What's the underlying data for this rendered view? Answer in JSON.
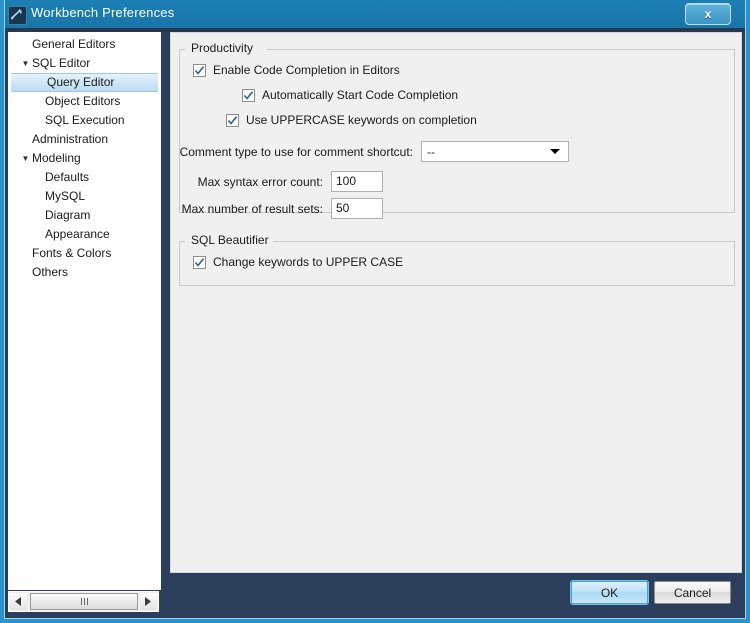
{
  "window": {
    "title": "Workbench Preferences",
    "icon": "workbench-icon",
    "close_label": "x"
  },
  "sidebar": {
    "items": [
      {
        "label": "General Editors",
        "level": 1,
        "twisty": "",
        "selected": false
      },
      {
        "label": "SQL Editor",
        "level": 1,
        "twisty": "▼",
        "selected": false
      },
      {
        "label": "Query Editor",
        "level": 2,
        "twisty": "",
        "selected": true
      },
      {
        "label": "Object Editors",
        "level": 2,
        "twisty": "",
        "selected": false
      },
      {
        "label": "SQL Execution",
        "level": 2,
        "twisty": "",
        "selected": false
      },
      {
        "label": "Administration",
        "level": 1,
        "twisty": "",
        "selected": false
      },
      {
        "label": "Modeling",
        "level": 1,
        "twisty": "▼",
        "selected": false
      },
      {
        "label": "Defaults",
        "level": 2,
        "twisty": "",
        "selected": false
      },
      {
        "label": "MySQL",
        "level": 2,
        "twisty": "",
        "selected": false
      },
      {
        "label": "Diagram",
        "level": 2,
        "twisty": "",
        "selected": false
      },
      {
        "label": "Appearance",
        "level": 2,
        "twisty": "",
        "selected": false
      },
      {
        "label": "Fonts & Colors",
        "level": 1,
        "twisty": "",
        "selected": false
      },
      {
        "label": "Others",
        "level": 1,
        "twisty": "",
        "selected": false
      }
    ],
    "scrollbar": {
      "left_arrow": "◄",
      "right_arrow": "►"
    }
  },
  "productivity": {
    "group_title": "Productivity",
    "enable_code_completion": {
      "label": "Enable Code Completion in Editors",
      "checked": true
    },
    "auto_start_completion": {
      "label": "Automatically Start Code Completion",
      "checked": true
    },
    "uppercase_keywords": {
      "label": "Use UPPERCASE keywords on completion",
      "checked": true
    },
    "comment_type": {
      "label": "Comment type to use for comment shortcut:",
      "value": "--",
      "options": [
        "--",
        "#"
      ]
    },
    "max_syntax_error_count": {
      "label": "Max syntax error count:",
      "value": "100"
    },
    "max_result_sets": {
      "label": "Max number of result sets:",
      "value": "50"
    }
  },
  "beautifier": {
    "group_title": "SQL Beautifier",
    "change_keywords_upper": {
      "label": "Change keywords to UPPER CASE",
      "checked": true
    }
  },
  "footer": {
    "ok_label": "OK",
    "cancel_label": "Cancel"
  },
  "colors": {
    "titlebar": "#1a79ad",
    "frame": "#2a93c9",
    "panel_bg": "#f0f0f0",
    "accent": "#2a93c9",
    "selection": "#cfe6f7",
    "check": "#2b5f9e"
  }
}
